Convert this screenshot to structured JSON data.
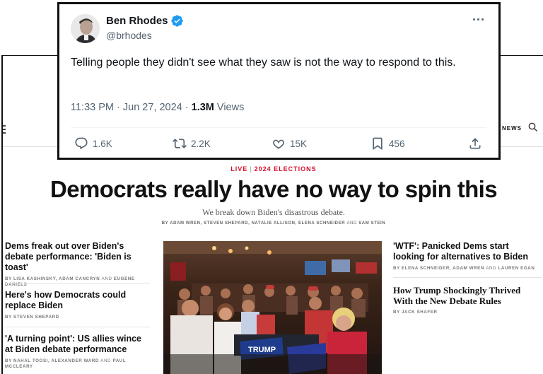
{
  "tweet": {
    "name": "Ben Rhodes",
    "handle": "@brhodes",
    "text": "Telling people they didn't see what they saw is not the way to respond to this.",
    "time": "11:33 PM · Jun 27, 2024",
    "dot": "·",
    "views_count": "1.3M",
    "views_label": "Views",
    "replies": "1.6K",
    "reposts": "2.2K",
    "likes": "15K",
    "bookmarks": "456",
    "icons": {
      "verified": "verified-badge-icon",
      "more": "more-options-icon",
      "reply": "reply-icon",
      "repost": "repost-icon",
      "like": "heart-icon",
      "bookmark": "bookmark-icon",
      "share": "share-icon"
    },
    "colors": {
      "verified": "#1d9bf0",
      "text": "#0f1419",
      "muted": "#536471"
    }
  },
  "article": {
    "nav_news": "NEWS",
    "kicker_live": "LIVE",
    "kicker_sep": "|",
    "kicker_topic": "2024 ELECTIONS",
    "headline": "Democrats really have no way to spin this",
    "dek": "We break down Biden's disastrous debate.",
    "bylines": {
      "names": "BY ADAM WREN, STEVEN SHEPARD, NATALIE ALLISON, ELENA SCHNEIDER",
      "and": "AND",
      "last": "SAM STEIN"
    },
    "left_stories": [
      {
        "headline": "Dems freak out over Biden's debate performance: 'Biden is toast'",
        "byline_a": "BY LISA KASHINSKY, ADAM CANCRYN",
        "and": "AND",
        "byline_b": "EUGENE DANIELS"
      },
      {
        "headline": "Here's how Democrats could replace Biden",
        "byline": "BY STEVEN SHEPARD"
      },
      {
        "headline": "'A turning point': US allies wince at Biden debate performance",
        "byline_a": "BY NAHAL TOOSI, ALEXANDER WARD",
        "and": "AND",
        "byline_b": "PAUL MCCLEARY"
      }
    ],
    "right_stories": [
      {
        "headline": "'WTF': Panicked Dems start looking for alternatives to Biden",
        "byline_a": "BY ELENA SCHNEIDER, ADAM WREN",
        "and": "AND",
        "byline_b": "LAUREN EGAN"
      },
      {
        "headline": "How Trump Shockingly Thrived With the New Debate Rules",
        "byline": "BY JACK SHAFER"
      }
    ],
    "photo_sign": "TRUMP",
    "colors": {
      "kicker": "#d6102d"
    }
  }
}
